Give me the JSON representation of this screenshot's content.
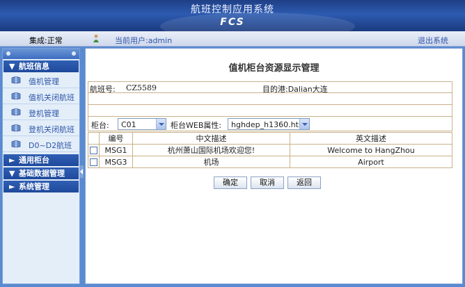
{
  "app": {
    "title": "航班控制应用系统",
    "subtitle": "FCS"
  },
  "status": {
    "state": "集成:正常",
    "user": "当前用户:admin",
    "logout": "退出系统"
  },
  "sidebar": {
    "groups": [
      {
        "label": "航班信息",
        "expanded": true,
        "items": [
          {
            "label": "值机管理",
            "icon": "book-icon"
          },
          {
            "label": "值机关闭航班",
            "icon": "book-icon"
          },
          {
            "label": "登机管理",
            "icon": "book-icon"
          },
          {
            "label": "登机关闭航班",
            "icon": "book-icon"
          },
          {
            "label": "D0~D2航班",
            "icon": "book-icon"
          }
        ]
      },
      {
        "label": "通用柜台",
        "expanded": false
      },
      {
        "label": "基础数据管理",
        "expanded": true
      },
      {
        "label": "系统管理",
        "expanded": false
      }
    ]
  },
  "main": {
    "title": "值机柜台资源显示管理",
    "flight_label": "航班号:",
    "flight_no": "CZ5589",
    "dest_label": "目的港:Dalian大连",
    "counter_label": "柜台:",
    "counter_value": "C01",
    "web_label": "柜台WEB属性:",
    "web_value": "hghdep_h1360.htm",
    "table": {
      "headers": [
        "",
        "编号",
        "中文描述",
        "英文描述"
      ],
      "rows": [
        {
          "code": "MSG1",
          "cn": "杭州萧山国际机场欢迎您!",
          "en": "Welcome to HangZhou"
        },
        {
          "code": "MSG3",
          "cn": "机场",
          "en": "Airport"
        }
      ]
    },
    "buttons": {
      "ok": "确定",
      "cancel": "取消",
      "back": "返回"
    }
  }
}
